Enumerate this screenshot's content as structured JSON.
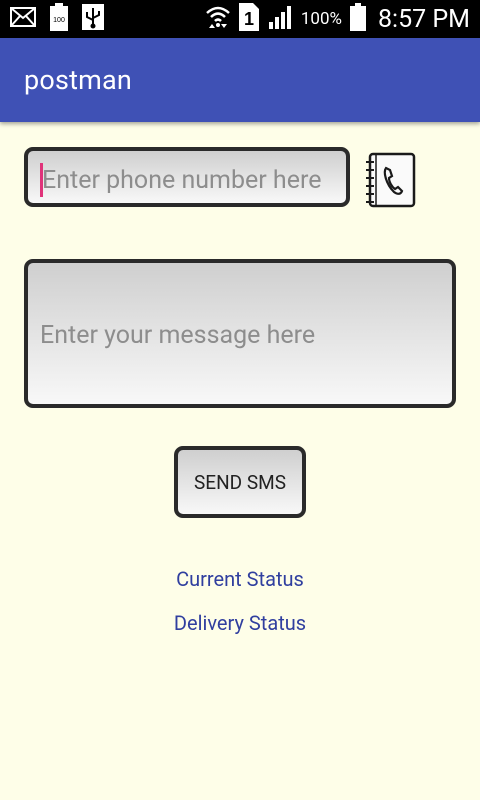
{
  "status_bar": {
    "battery_level": "100",
    "battery_percent": "100%",
    "time": "8:57 PM",
    "sim_slot": "1",
    "icons": [
      "mail-icon",
      "battery-full-icon",
      "usb-icon",
      "wifi-icon",
      "sim-icon",
      "signal-icon",
      "battery-icon"
    ]
  },
  "app_bar": {
    "title": "postman",
    "color": "#3f51b5"
  },
  "form": {
    "phone_placeholder": "Enter phone number here",
    "message_placeholder": "Enter your message here",
    "send_label": "SEND SMS",
    "contacts_icon": "contacts-book-icon"
  },
  "links": {
    "current_status": "Current Status",
    "delivery_status": "Delivery Status"
  },
  "colors": {
    "background": "#fefee8",
    "link": "#303f9f",
    "cursor": "#e0337a"
  }
}
